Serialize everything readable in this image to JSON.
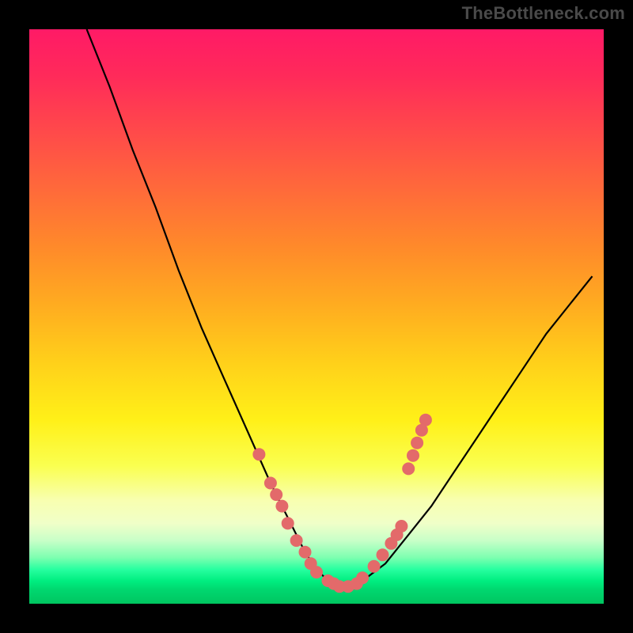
{
  "watermark": "TheBottleneck.com",
  "chart_data": {
    "type": "line",
    "title": "",
    "xlabel": "",
    "ylabel": "",
    "xlim": [
      0,
      100
    ],
    "ylim": [
      0,
      100
    ],
    "grid": false,
    "series": [
      {
        "name": "bottleneck-curve",
        "x": [
          10,
          14,
          18,
          22,
          26,
          30,
          34,
          38,
          42,
          44,
          46,
          48,
          50,
          52,
          54,
          56,
          58,
          62,
          66,
          70,
          74,
          78,
          82,
          86,
          90,
          94,
          98
        ],
        "values": [
          100,
          90,
          79,
          69,
          58,
          48,
          39,
          30,
          21,
          17,
          13,
          9,
          6,
          4,
          3,
          3,
          4,
          7,
          12,
          17,
          23,
          29,
          35,
          41,
          47,
          52,
          57
        ]
      }
    ],
    "markers": {
      "name": "highlight-points",
      "color": "#e36a6a",
      "points": [
        [
          40,
          26
        ],
        [
          42,
          21
        ],
        [
          43,
          19
        ],
        [
          44,
          17
        ],
        [
          45,
          14
        ],
        [
          46.5,
          11
        ],
        [
          48,
          9
        ],
        [
          49,
          7
        ],
        [
          50,
          5.5
        ],
        [
          52,
          4
        ],
        [
          53,
          3.5
        ],
        [
          54,
          3
        ],
        [
          55.5,
          3
        ],
        [
          57,
          3.5
        ],
        [
          58,
          4.5
        ],
        [
          60,
          6.5
        ],
        [
          61.5,
          8.5
        ],
        [
          63,
          10.5
        ],
        [
          64,
          12
        ],
        [
          64.8,
          13.5
        ],
        [
          66,
          23.5
        ],
        [
          66.8,
          25.8
        ],
        [
          67.5,
          28
        ],
        [
          68.3,
          30.2
        ],
        [
          69,
          32
        ]
      ]
    },
    "background_bands": [
      {
        "from": 0,
        "to": 76,
        "zone": "gradient-red-to-yellow"
      },
      {
        "from": 76,
        "to": 88,
        "zone": "pale-yellow"
      },
      {
        "from": 88,
        "to": 100,
        "zone": "green-bands"
      }
    ]
  },
  "colors": {
    "curve_stroke": "#000000",
    "marker_fill": "#e36a6a",
    "frame_bg": "#000000",
    "watermark_text": "#4a4a4a"
  }
}
